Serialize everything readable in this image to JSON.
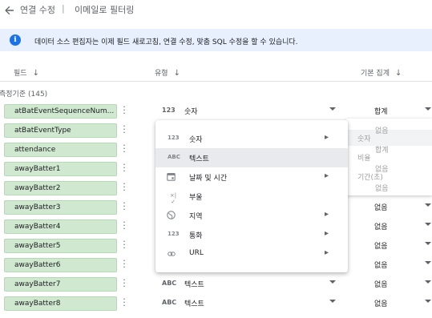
{
  "header": {
    "breadcrumb_1": "연결 수정",
    "separator": "|",
    "breadcrumb_2": "이메일로 필터링"
  },
  "banner": {
    "icon": "info-icon",
    "text": "데이터 소스 편집자는 이제 필드 새로고침, 연결 수정, 맞춤 SQL 수정을 할 수 있습니다."
  },
  "columns": {
    "field": "필드",
    "type": "유형",
    "aggregation": "기본 집계"
  },
  "group": {
    "label": "측정기준 (145)"
  },
  "rows": [
    {
      "name": "atBatEventSequenceNum...",
      "type_icon": "123",
      "type": "숫자",
      "agg": "합계"
    },
    {
      "name": "atBatEventType",
      "type_icon": "",
      "type": "",
      "agg": "없음"
    },
    {
      "name": "attendance",
      "type_icon": "",
      "type": "",
      "agg": "합계"
    },
    {
      "name": "awayBatter1",
      "type_icon": "",
      "type": "",
      "agg": "없음"
    },
    {
      "name": "awayBatter2",
      "type_icon": "",
      "type": "",
      "agg": "없음"
    },
    {
      "name": "awayBatter3",
      "type_icon": "",
      "type": "",
      "agg": "없음"
    },
    {
      "name": "awayBatter4",
      "type_icon": "",
      "type": "",
      "agg": "없음"
    },
    {
      "name": "awayBatter5",
      "type_icon": "",
      "type": "",
      "agg": "없음"
    },
    {
      "name": "awayBatter6",
      "type_icon": "",
      "type": "",
      "agg": "없음"
    },
    {
      "name": "awayBatter7",
      "type_icon": "ABC",
      "type": "텍스트",
      "agg": "없음"
    },
    {
      "name": "awayBatter8",
      "type_icon": "ABC",
      "type": "텍스트",
      "agg": "없음"
    }
  ],
  "agg_menu_ghost": {
    "items": [
      "숫자",
      "비율",
      "기간(초)"
    ],
    "values": [
      "없음",
      "합계",
      "없음",
      "없음"
    ]
  },
  "type_menu": {
    "items": [
      {
        "icon": "123",
        "label": "숫자",
        "submenu": true
      },
      {
        "icon": "ABC",
        "label": "텍스트",
        "submenu": false,
        "selected": true
      },
      {
        "icon": "calendar-icon",
        "label": "날짜 및 시간",
        "submenu": true
      },
      {
        "icon": "boolean-icon",
        "label": "부울",
        "submenu": false
      },
      {
        "icon": "globe-icon",
        "label": "지역",
        "submenu": true
      },
      {
        "icon": "123",
        "label": "통화",
        "submenu": true
      },
      {
        "icon": "link-icon",
        "label": "URL",
        "submenu": true
      }
    ]
  }
}
